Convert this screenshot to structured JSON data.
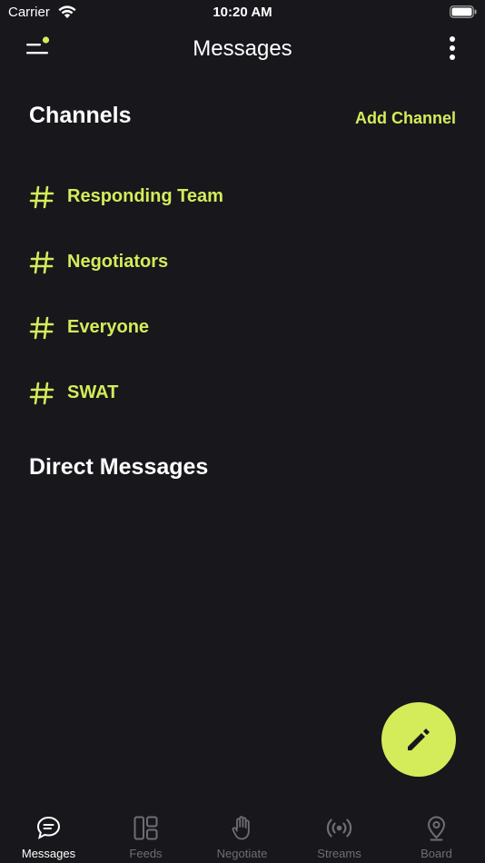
{
  "status_bar": {
    "carrier": "Carrier",
    "time": "10:20 AM"
  },
  "nav": {
    "title": "Messages",
    "menu_icon": "menu-with-dot-icon",
    "more_icon": "vertical-ellipsis-icon"
  },
  "channels": {
    "title": "Channels",
    "add_label": "Add Channel",
    "items": [
      {
        "label": "Responding Team"
      },
      {
        "label": "Negotiators"
      },
      {
        "label": "Everyone"
      },
      {
        "label": "SWAT"
      }
    ]
  },
  "direct_messages": {
    "title": "Direct Messages"
  },
  "fab": {
    "icon": "pencil-icon"
  },
  "tabs": [
    {
      "label": "Messages",
      "icon": "chat-bubble-icon",
      "active": true
    },
    {
      "label": "Feeds",
      "icon": "grid-icon",
      "active": false
    },
    {
      "label": "Negotiate",
      "icon": "hand-icon",
      "active": false
    },
    {
      "label": "Streams",
      "icon": "broadcast-icon",
      "active": false
    },
    {
      "label": "Board",
      "icon": "map-pin-icon",
      "active": false
    }
  ],
  "colors": {
    "background": "#18171b",
    "accent": "#d4ec5a",
    "text": "#ffffff",
    "inactive": "#6e6e76"
  }
}
